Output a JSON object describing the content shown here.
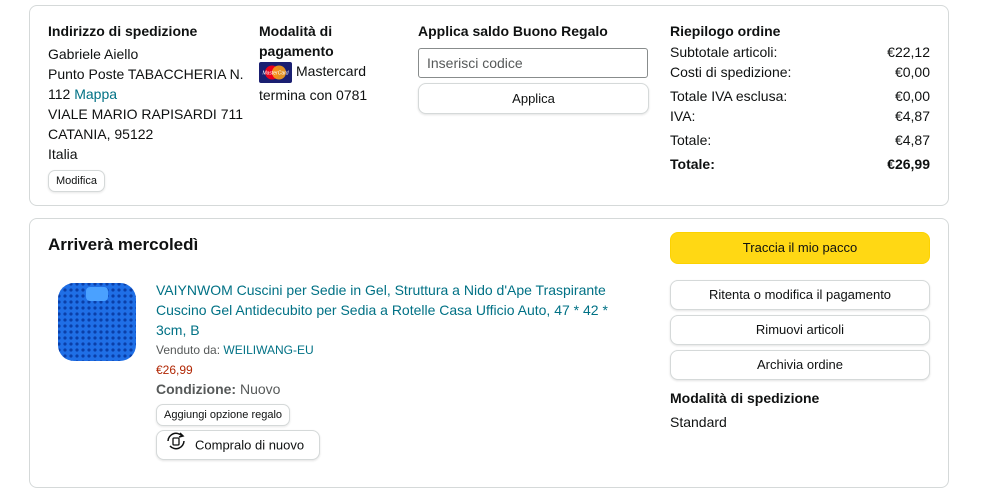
{
  "shipping": {
    "title": "Indirizzo di spedizione",
    "name": "Gabriele Aiello",
    "line1": "Punto Poste TABACCHERIA N.",
    "line2_prefix": "112 ",
    "map_link": "Mappa",
    "street": "VIALE MARIO RAPISARDI 711",
    "city": "CATANIA, 95122",
    "country": "Italia",
    "edit_label": "Modifica"
  },
  "payment": {
    "title_line1": "Modalità di",
    "title_line2": "pagamento",
    "card_name": "Mastercard",
    "card_ending": "termina con 0781",
    "icon": "mastercard-icon"
  },
  "gift": {
    "title": "Applica saldo Buono Regalo",
    "placeholder": "Inserisci codice",
    "apply_label": "Applica"
  },
  "summary": {
    "title": "Riepilogo ordine",
    "rows": [
      {
        "label": "Subtotale articoli:",
        "value": "€22,12"
      },
      {
        "label": "Costi di spedizione:",
        "value": "€0,00"
      },
      {
        "label": "Totale IVA esclusa:",
        "value": "€0,00"
      },
      {
        "label": "IVA:",
        "value": "€4,87"
      },
      {
        "label": "Totale:",
        "value": "€4,87"
      },
      {
        "label": "Totale:",
        "value": "€26,99"
      }
    ]
  },
  "delivery": {
    "title": "Arriverà mercoledì",
    "product_title": "VAIYNWOM Cuscini per Sedie in Gel, Struttura a Nido d'Ape Traspirante Cuscino Gel Antidecubito per Sedia a Rotelle Casa Ufficio Auto, 47 * 42 * 3cm, B",
    "sold_by_label": "Venduto da: ",
    "seller": "WEILIWANG-EU",
    "price": "€26,99",
    "condition_label": "Condizione:",
    "condition_value": "Nuovo",
    "gift_option_label": "Aggiungi opzione regalo",
    "buy_again_label": "Compralo di nuovo"
  },
  "actions": {
    "track_label": "Traccia il mio pacco",
    "return_label": "Ritenta o modifica il pagamento",
    "remove_label": "Rimuovi articoli",
    "archive_label": "Archivia ordine",
    "shipping_method_title": "Modalità di spedizione",
    "shipping_method_value": "Standard"
  },
  "colors": {
    "link": "#007185",
    "price": "#b12704",
    "primary_button": "#ffd814",
    "border": "#d5d9d9"
  }
}
